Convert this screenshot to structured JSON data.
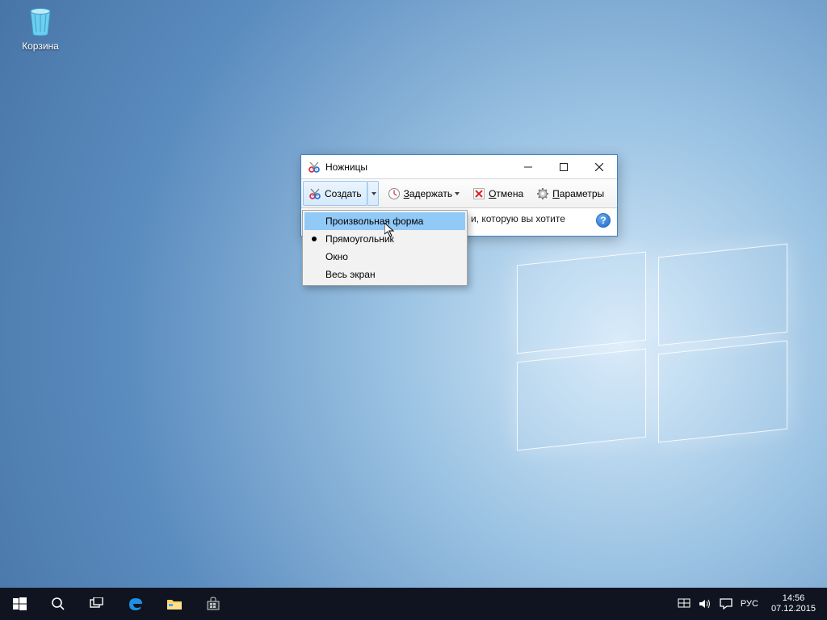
{
  "desktop": {
    "recycle_bin_label": "Корзина"
  },
  "window": {
    "title": "Ножницы",
    "toolbar": {
      "new_label": "Создать",
      "delay_label_pre": "З",
      "delay_label_post": "адержать",
      "cancel_label_pre": "О",
      "cancel_label_post": "тмена",
      "options_label_pre": "П",
      "options_label_post": "араметры"
    },
    "hint_fragment": "и, которую вы хотите",
    "menu": {
      "items": [
        {
          "label": "Произвольная форма",
          "selected": false,
          "highlighted": true
        },
        {
          "label": "Прямоугольник",
          "selected": true,
          "highlighted": false
        },
        {
          "label": "Окно",
          "selected": false,
          "highlighted": false
        },
        {
          "label": "Весь экран",
          "selected": false,
          "highlighted": false
        }
      ]
    }
  },
  "taskbar": {
    "lang": "РУС",
    "time": "14:56",
    "date": "07.12.2015"
  }
}
